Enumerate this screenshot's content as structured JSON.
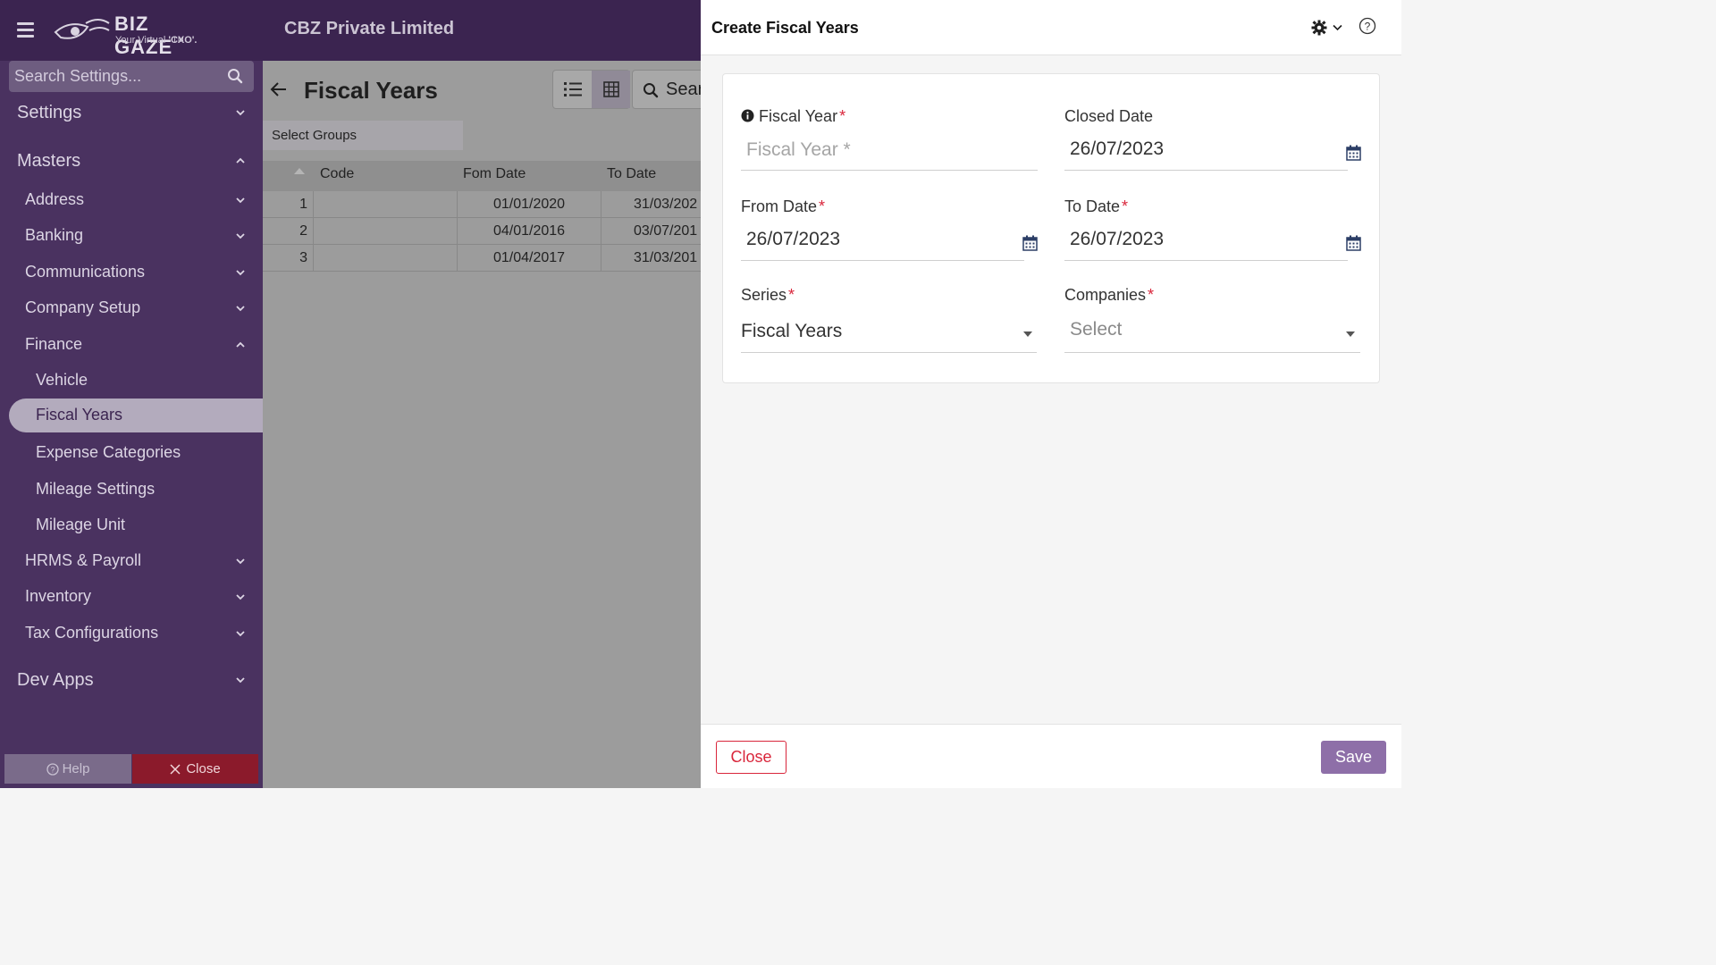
{
  "header": {
    "logo_text": "BIZ GAZE",
    "logo_tm": "TM",
    "logo_tag_prefix": "Your Virtual ",
    "logo_tag_bold": "'CXO'.",
    "company": "CBZ Private Limited"
  },
  "sidebar": {
    "search_placeholder": "Search Settings...",
    "settings": "Settings",
    "masters": "Masters",
    "address": "Address",
    "banking": "Banking",
    "communications": "Communications",
    "company_setup": "Company Setup",
    "finance": "Finance",
    "vehicle": "Vehicle",
    "fiscal_years": "Fiscal Years",
    "expense_categories": "Expense Categories",
    "mileage_settings": "Mileage Settings",
    "mileage_unit": "Mileage Unit",
    "hrms_payroll": "HRMS & Payroll",
    "inventory": "Inventory",
    "tax_configurations": "Tax Configurations",
    "dev_apps": "Dev Apps",
    "help": "Help",
    "close": "Close"
  },
  "list": {
    "title": "Fiscal Years",
    "search_text": "Sear",
    "select_groups": "Select Groups",
    "columns": {
      "code": "Code",
      "from": "Fom Date",
      "to": "To Date"
    },
    "rows": [
      {
        "num": "1",
        "code": "",
        "from": "01/01/2020",
        "to": "31/03/202"
      },
      {
        "num": "2",
        "code": "",
        "from": "04/01/2016",
        "to": "03/07/201"
      },
      {
        "num": "3",
        "code": "",
        "from": "01/04/2017",
        "to": "31/03/201"
      }
    ]
  },
  "form": {
    "title": "Create Fiscal Years",
    "fiscal_year_label": "Fiscal Year",
    "fiscal_year_placeholder": "Fiscal Year *",
    "closed_date_label": "Closed Date",
    "closed_date_value": "26/07/2023",
    "from_date_label": "From Date",
    "from_date_value": "26/07/2023",
    "to_date_label": "To Date",
    "to_date_value": "26/07/2023",
    "series_label": "Series",
    "series_value": "Fiscal Years",
    "companies_label": "Companies",
    "companies_placeholder": "Select",
    "required_mark": "*",
    "close_button": "Close",
    "save_button": "Save"
  },
  "colors": {
    "header_bg": "#3b2450",
    "sidebar_bg": "#4a3260",
    "accent": "#8e6fa8",
    "required": "#d9263b",
    "danger": "#8b1a2b"
  }
}
